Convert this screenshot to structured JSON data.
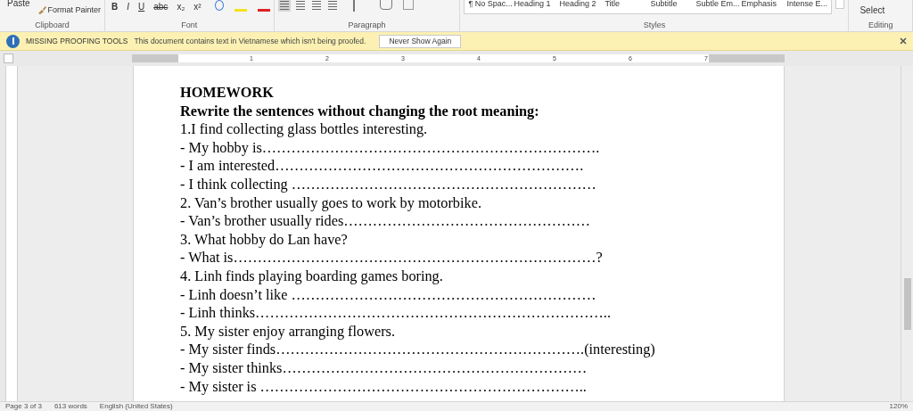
{
  "ribbon": {
    "clipboard": {
      "paste": "Paste",
      "format_painter": "Format Painter",
      "label": "Clipboard"
    },
    "font": {
      "buttons": [
        "B",
        "I",
        "U",
        "abc",
        "x₂",
        "x²"
      ],
      "label": "Font"
    },
    "paragraph": {
      "label": "Paragraph"
    },
    "styles": {
      "items": [
        "¶ No Spac...",
        "Heading 1",
        "Heading 2",
        "Title",
        "Subtitle",
        "Subtle Em...",
        "Emphasis",
        "Intense E..."
      ],
      "label": "Styles"
    },
    "editing": {
      "select": "Select",
      "label": "Editing"
    }
  },
  "message_bar": {
    "title": "MISSING PROOFING TOOLS",
    "text": "This document contains text in Vietnamese which isn't being proofed.",
    "button": "Never Show Again"
  },
  "ruler": {
    "numbers": [
      "1",
      "2",
      "3",
      "4",
      "5",
      "6",
      "7"
    ]
  },
  "document": {
    "lines": [
      {
        "kind": "heading",
        "text": "HOMEWORK"
      },
      {
        "kind": "heading",
        "text": "Rewrite the sentences without changing the root meaning:"
      },
      {
        "kind": "text",
        "text": "1.I find collecting glass bottles interesting."
      },
      {
        "kind": "text",
        "text": "- My hobby is……………………………………………………………."
      },
      {
        "kind": "text",
        "text": "- I am interested………………………………………………………."
      },
      {
        "kind": "text",
        "text": "- I think collecting ………………………………………………………"
      },
      {
        "kind": "text",
        "text": "2. Van’s brother usually goes to work by motorbike."
      },
      {
        "kind": "text",
        "text": "-  Van’s brother usually rides……………………………………………"
      },
      {
        "kind": "text",
        "text": "3. What hobby do Lan have?"
      },
      {
        "kind": "text",
        "text": "- What is…………………………………………………………………?"
      },
      {
        "kind": "text",
        "text": "4. Linh finds playing boarding games boring."
      },
      {
        "kind": "text",
        "text": "- Linh doesn’t like ………………………………………………………"
      },
      {
        "kind": "text",
        "text": "- Linh thinks……………………………………………………………….."
      },
      {
        "kind": "text",
        "text": "5. My sister enjoy arranging flowers."
      },
      {
        "kind": "text",
        "text": "- My sister finds……………………………………………………….(interesting)"
      },
      {
        "kind": "text",
        "text": "- My sister thinks………………………………………………………"
      },
      {
        "kind": "text",
        "text": "- My sister is ………………………………………………………….."
      }
    ]
  },
  "status_bar": {
    "page": "Page 3 of 3",
    "words": "613 words",
    "language": "English (United States)",
    "zoom": "120%"
  }
}
